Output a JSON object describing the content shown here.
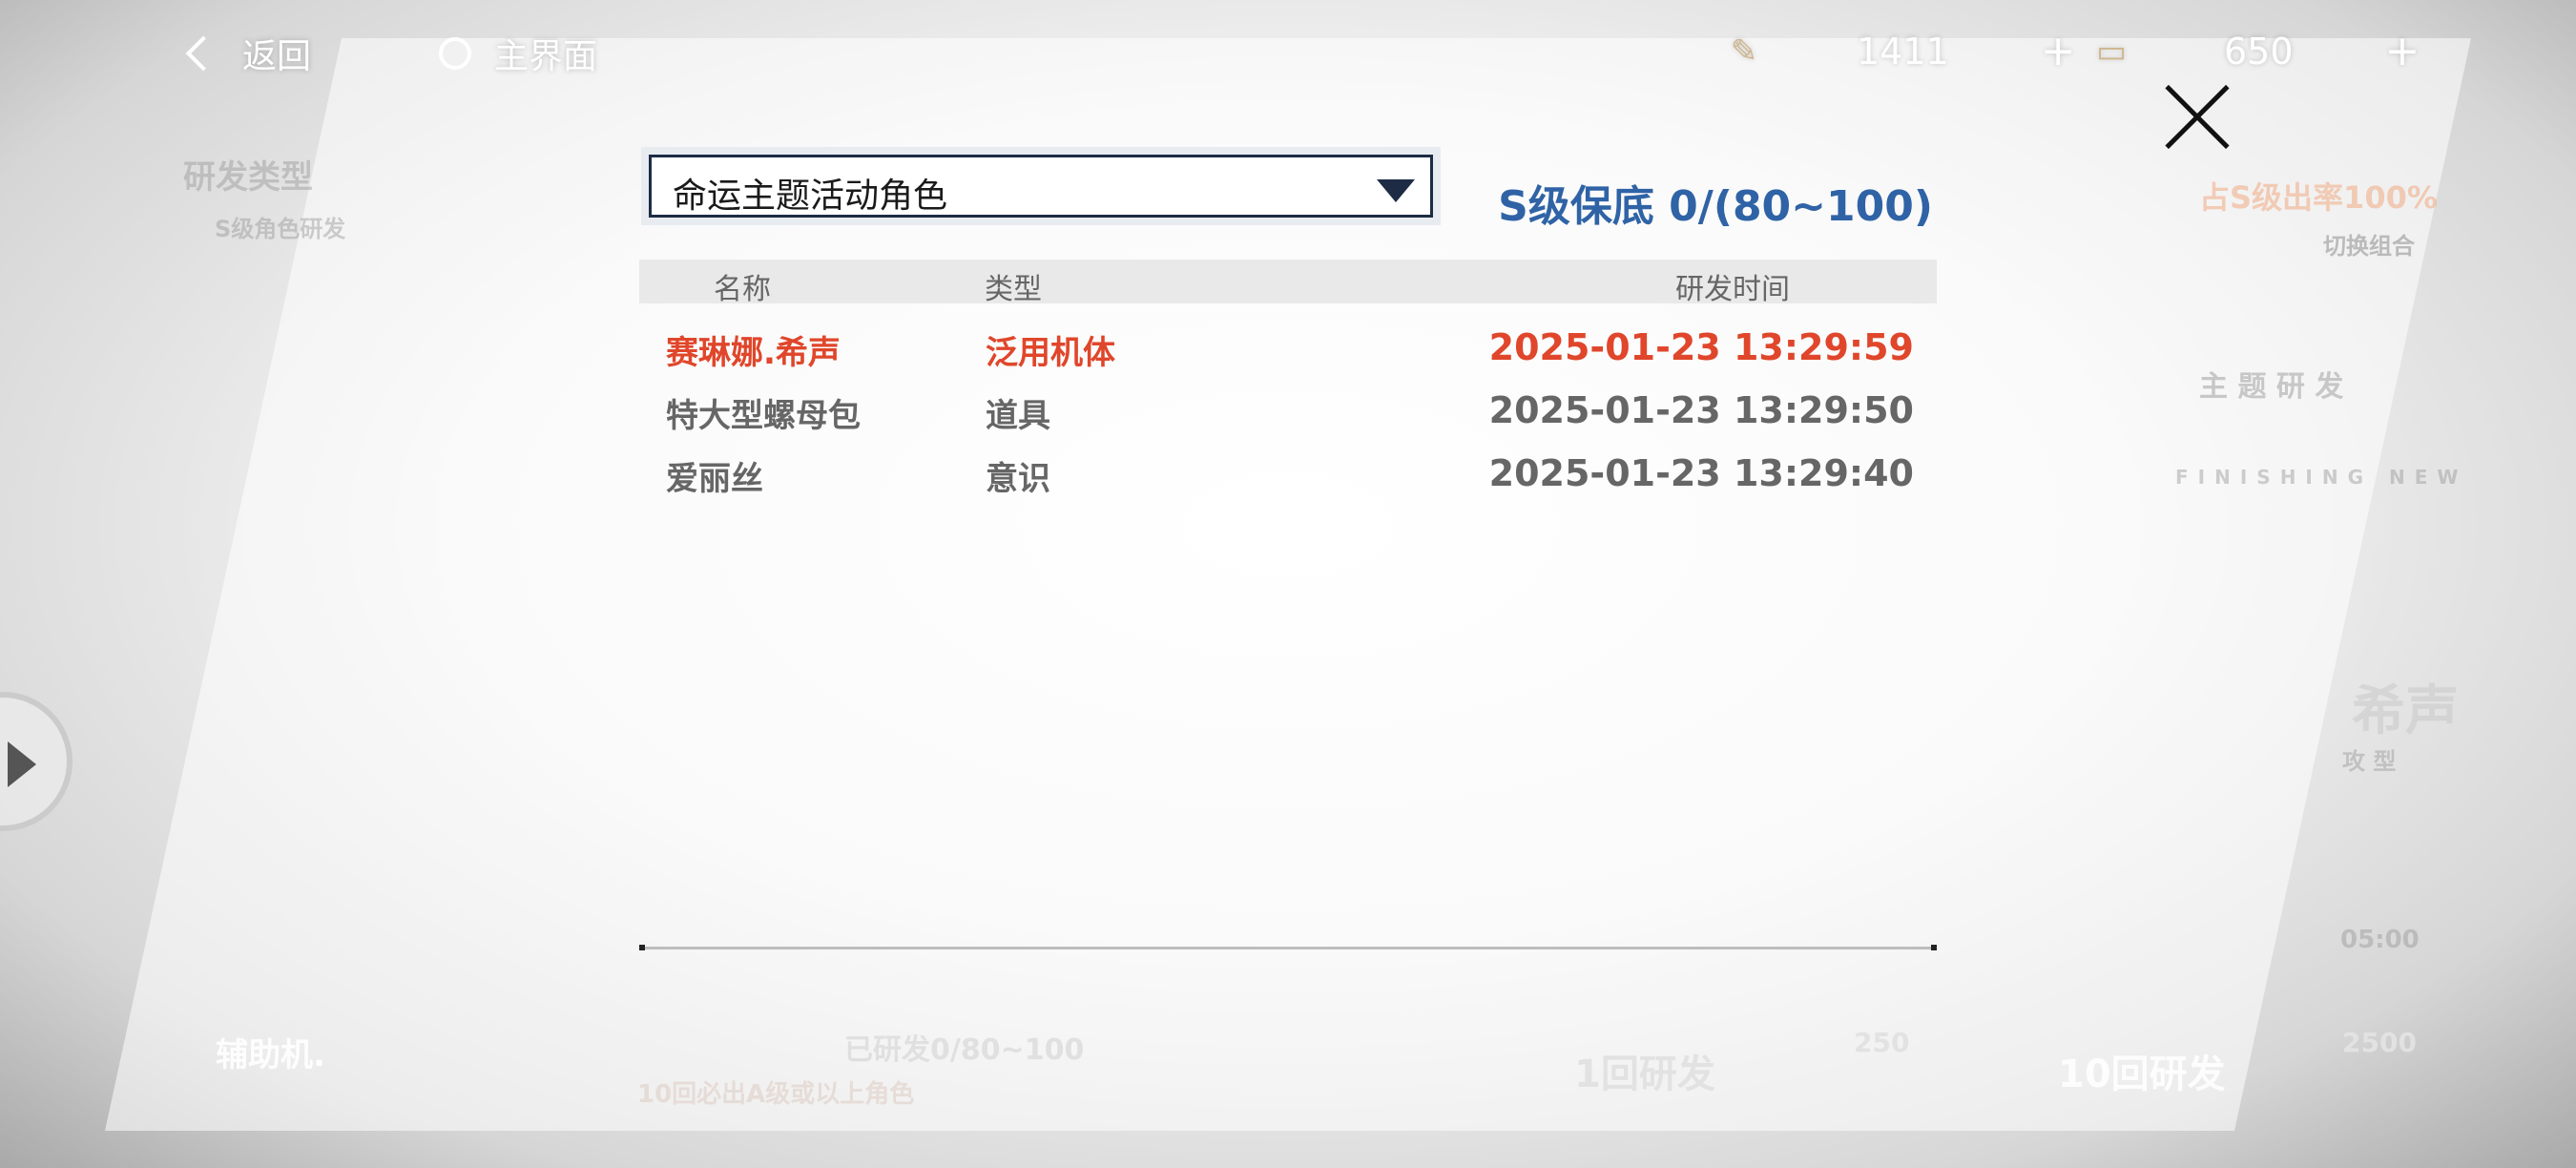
{
  "topbar": {
    "back_label": "返回",
    "home_label": "主界面",
    "resources": [
      {
        "icon": "pen-icon",
        "value": "1411",
        "plus": "+"
      },
      {
        "icon": "ticket-icon",
        "value": "650",
        "plus": "+"
      }
    ]
  },
  "modal": {
    "filter_selected": "命运主题活动角色",
    "pity_text": "S级保底 0/(80~100)",
    "columns": {
      "name": "名称",
      "type": "类型",
      "time": "研发时间"
    },
    "rows": [
      {
        "name": "赛琳娜.希声",
        "type": "泛用机体",
        "time": "2025-01-23 13:29:59",
        "highlight": true
      },
      {
        "name": "特大型螺母包",
        "type": "道具",
        "time": "2025-01-23 13:29:50",
        "highlight": false
      },
      {
        "name": "爱丽丝",
        "type": "意识",
        "time": "2025-01-23 13:29:40",
        "highlight": false
      }
    ]
  },
  "background": {
    "left_title": "研发类型",
    "left_sub": "S级角色研发",
    "assist_label": "辅助机.",
    "rate_text": "占S级出率100%",
    "switch_label": "切换组合",
    "theme_label": "主 题 研 发",
    "finishing_text": "FINISHING NEW",
    "char_name": "希声",
    "char_type": "攻 型",
    "time_label": "05:00",
    "pity_progress": "已研发0/80~100",
    "guarantee_text": "10回必出A级或以上角色",
    "draw1_label": "1回研发",
    "draw1_cost": "250",
    "draw10_label": "10回研发",
    "draw10_cost": "2500"
  },
  "colors": {
    "pity_blue": "#2f63a6",
    "highlight_red": "#e0462b",
    "row_gray": "#666666"
  }
}
